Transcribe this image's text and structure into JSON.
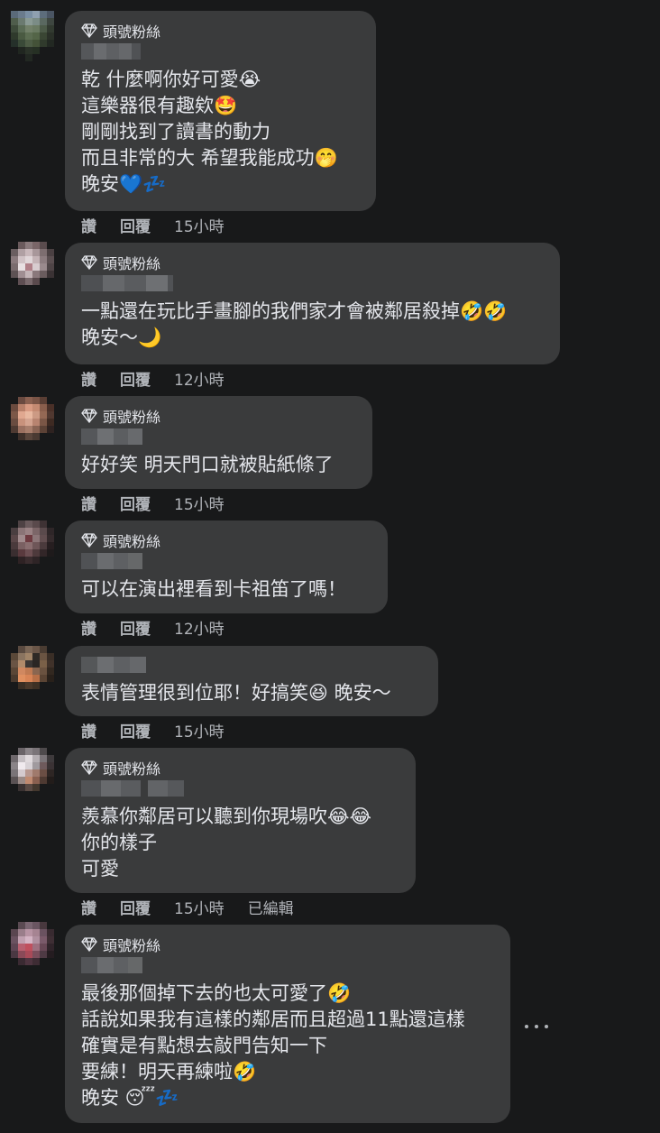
{
  "badge_label": "頭號粉絲",
  "actions": {
    "like": "讚",
    "reply": "回覆"
  },
  "comments": [
    {
      "badge": true,
      "lines": [
        "乾 什麼啊你好可愛😭",
        "這樂器很有趣欸🤩",
        "剛剛找到了讀書的動力",
        "而且非常的大 希望我能成功🤭",
        "晚安💙💤"
      ],
      "time": "15小時",
      "edited": ""
    },
    {
      "badge": true,
      "lines": [
        "一點還在玩比手畫腳的我們家才會被鄰居殺掉🤣🤣",
        "晚安～🌙"
      ],
      "time": "12小時",
      "edited": ""
    },
    {
      "badge": true,
      "lines": [
        "好好笑 明天門口就被貼紙條了"
      ],
      "time": "15小時",
      "edited": ""
    },
    {
      "badge": true,
      "lines": [
        "可以在演出裡看到卡祖笛了嗎！"
      ],
      "time": "12小時",
      "edited": ""
    },
    {
      "badge": false,
      "lines": [
        "表情管理很到位耶！好搞笑😆 晚安～"
      ],
      "time": "15小時",
      "edited": ""
    },
    {
      "badge": true,
      "lines": [
        "羨慕你鄰居可以聽到你現場吹😂😂",
        "你的樣子",
        "可愛"
      ],
      "time": "15小時",
      "edited": "已編輯"
    },
    {
      "badge": true,
      "lines": [
        "最後那個掉下去的也太可愛了🤣",
        "話說如果我有這樣的鄰居而且超過11點還這樣",
        "確實是有點想去敲門告知一下",
        "要練！明天再練啦🤣",
        "晚安 😴💤"
      ],
      "time": "",
      "edited": ""
    }
  ]
}
